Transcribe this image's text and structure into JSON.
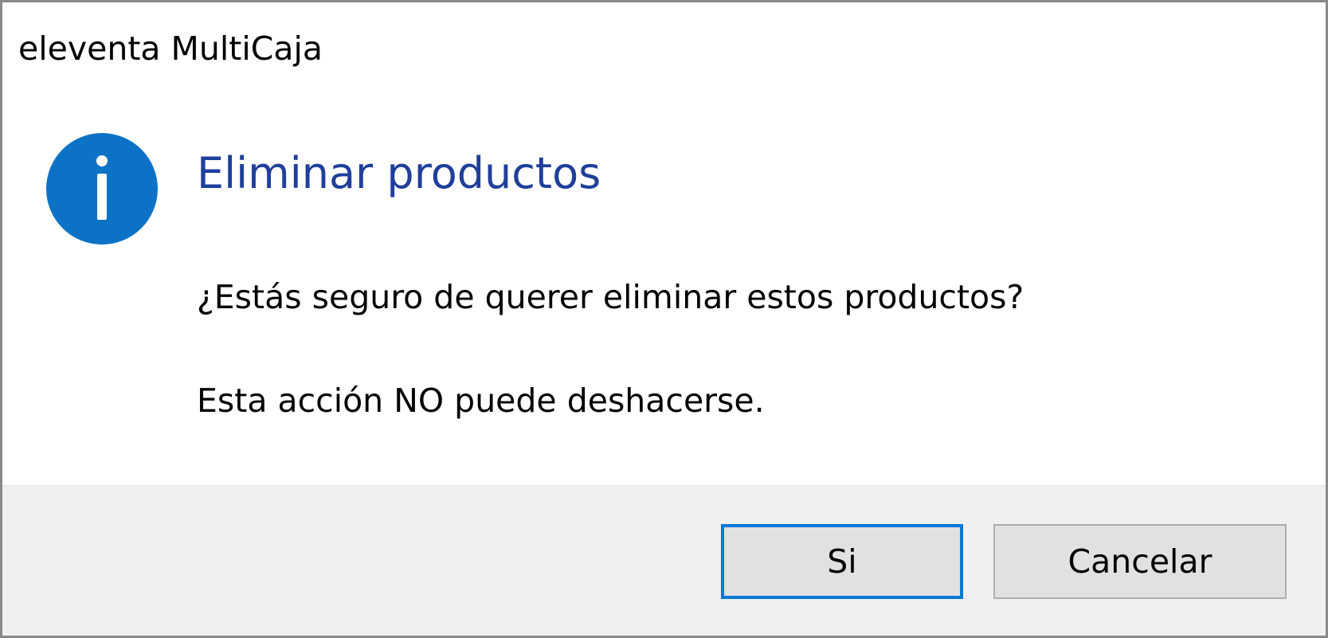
{
  "window": {
    "title": "eleventa MultiCaja"
  },
  "dialog": {
    "icon": "info-icon",
    "heading": "Eliminar productos",
    "message_line1": "¿Estás seguro de querer eliminar estos productos?",
    "message_line2": "Esta acción NO puede deshacerse."
  },
  "buttons": {
    "yes_label": "Si",
    "cancel_label": "Cancelar"
  },
  "colors": {
    "accent": "#0078d7",
    "heading": "#1f3f9a",
    "footer_bg": "#f0f0f0"
  }
}
